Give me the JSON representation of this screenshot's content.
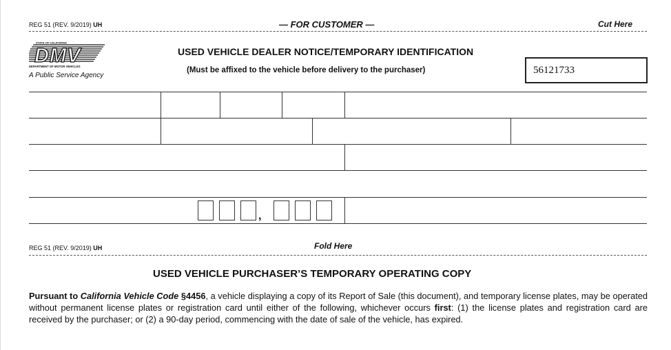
{
  "header": {
    "form_number_prefix": "REG 51 (REV. 9/2019) ",
    "form_number_suffix": "UH",
    "for_customer": "— FOR CUSTOMER —",
    "cut_here": "Cut Here"
  },
  "logo": {
    "state_text": "STATE OF CALIFORNIA",
    "wordmark": "DMV",
    "dept_text": "DEPARTMENT OF MOTOR VEHICLES",
    "agency": "A Public Service Agency"
  },
  "notice": {
    "title": "USED VEHICLE DEALER NOTICE/TEMPORARY IDENTIFICATION",
    "subtitle": "(Must be affixed to the vehicle before delivery to the purchaser)",
    "id_number": "56121733"
  },
  "odometer": {
    "comma": ","
  },
  "fold": {
    "form_number_prefix": "REG 51 (REV. 9/2019) ",
    "form_number_suffix": "UH",
    "fold_here": "Fold Here"
  },
  "operating_copy": {
    "title": "USED VEHICLE PURCHASER’S TEMPORARY OPERATING COPY",
    "p_pursuant": "Pursuant to ",
    "p_code_italic": "California Vehicle Code",
    "p_section": " §4456",
    "p_body1": ", a vehicle displaying a copy of its Report of Sale (this document), and temporary license plates, may be operated without permanent license plates or registration card until either of the following, whichever occurs ",
    "p_first": "first",
    "p_body2": ": (1) the license plates and registration card are received by the purchaser; or (2) a 90-day period, commencing with the date of sale of the vehicle, has expired."
  }
}
